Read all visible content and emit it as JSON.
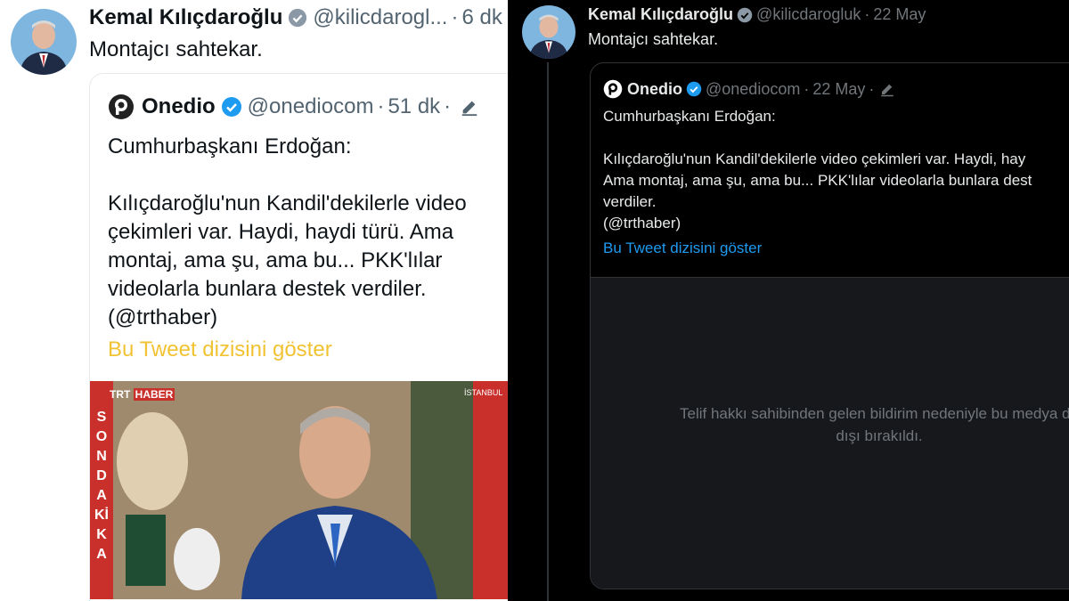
{
  "left": {
    "author": {
      "name": "Kemal Kılıçdaroğlu",
      "handle": "@kilicdarogl...",
      "time": "6 dk"
    },
    "tweet_text": "Montajcı sahtekar.",
    "quote": {
      "name": "Onedio",
      "handle": "@onediocom",
      "time": "51 dk",
      "text": "Cumhurbaşkanı Erdoğan:\n\nKılıçdaroğlu'nun Kandil'dekilerle video\nçekimleri var. Haydi, haydi türü. Ama\nmontaj, ama şu, ama bu... PKK'lılar\nvideolarla bunlara destek verdiler.\n(@trthaber)",
      "show_thread": "Bu Tweet dizisini göster",
      "media": {
        "channel": "TRT",
        "channel_suffix": "HABER",
        "location": "İSTANBUL",
        "banner": "SON DAKİKA"
      }
    }
  },
  "right": {
    "author": {
      "name": "Kemal Kılıçdaroğlu",
      "handle": "@kilicdarogluk",
      "time": "22 May"
    },
    "tweet_text": "Montajcı sahtekar.",
    "quote": {
      "name": "Onedio",
      "handle": "@onediocom",
      "time": "22 May",
      "text": "Cumhurbaşkanı Erdoğan:\n\nKılıçdaroğlu'nun Kandil'dekilerle video çekimleri var. Haydi, hay\nAma montaj, ama şu, ama bu... PKK'lılar videolarla bunlara dest\nverdiler.\n(@trthaber)",
      "show_thread": "Bu Tweet dizisini göster",
      "media_message": "Telif hakkı sahibinden gelen bildirim nedeniyle bu medya de\ndışı bırakıldı."
    }
  },
  "colors": {
    "verified": "#1d9bf0",
    "link_dark": "#1d9bf0",
    "link_light": "#f1c232",
    "dark_bg": "#000000"
  },
  "icons": [
    "verified-icon",
    "onedio-logo",
    "edit-icon",
    "avatar"
  ]
}
